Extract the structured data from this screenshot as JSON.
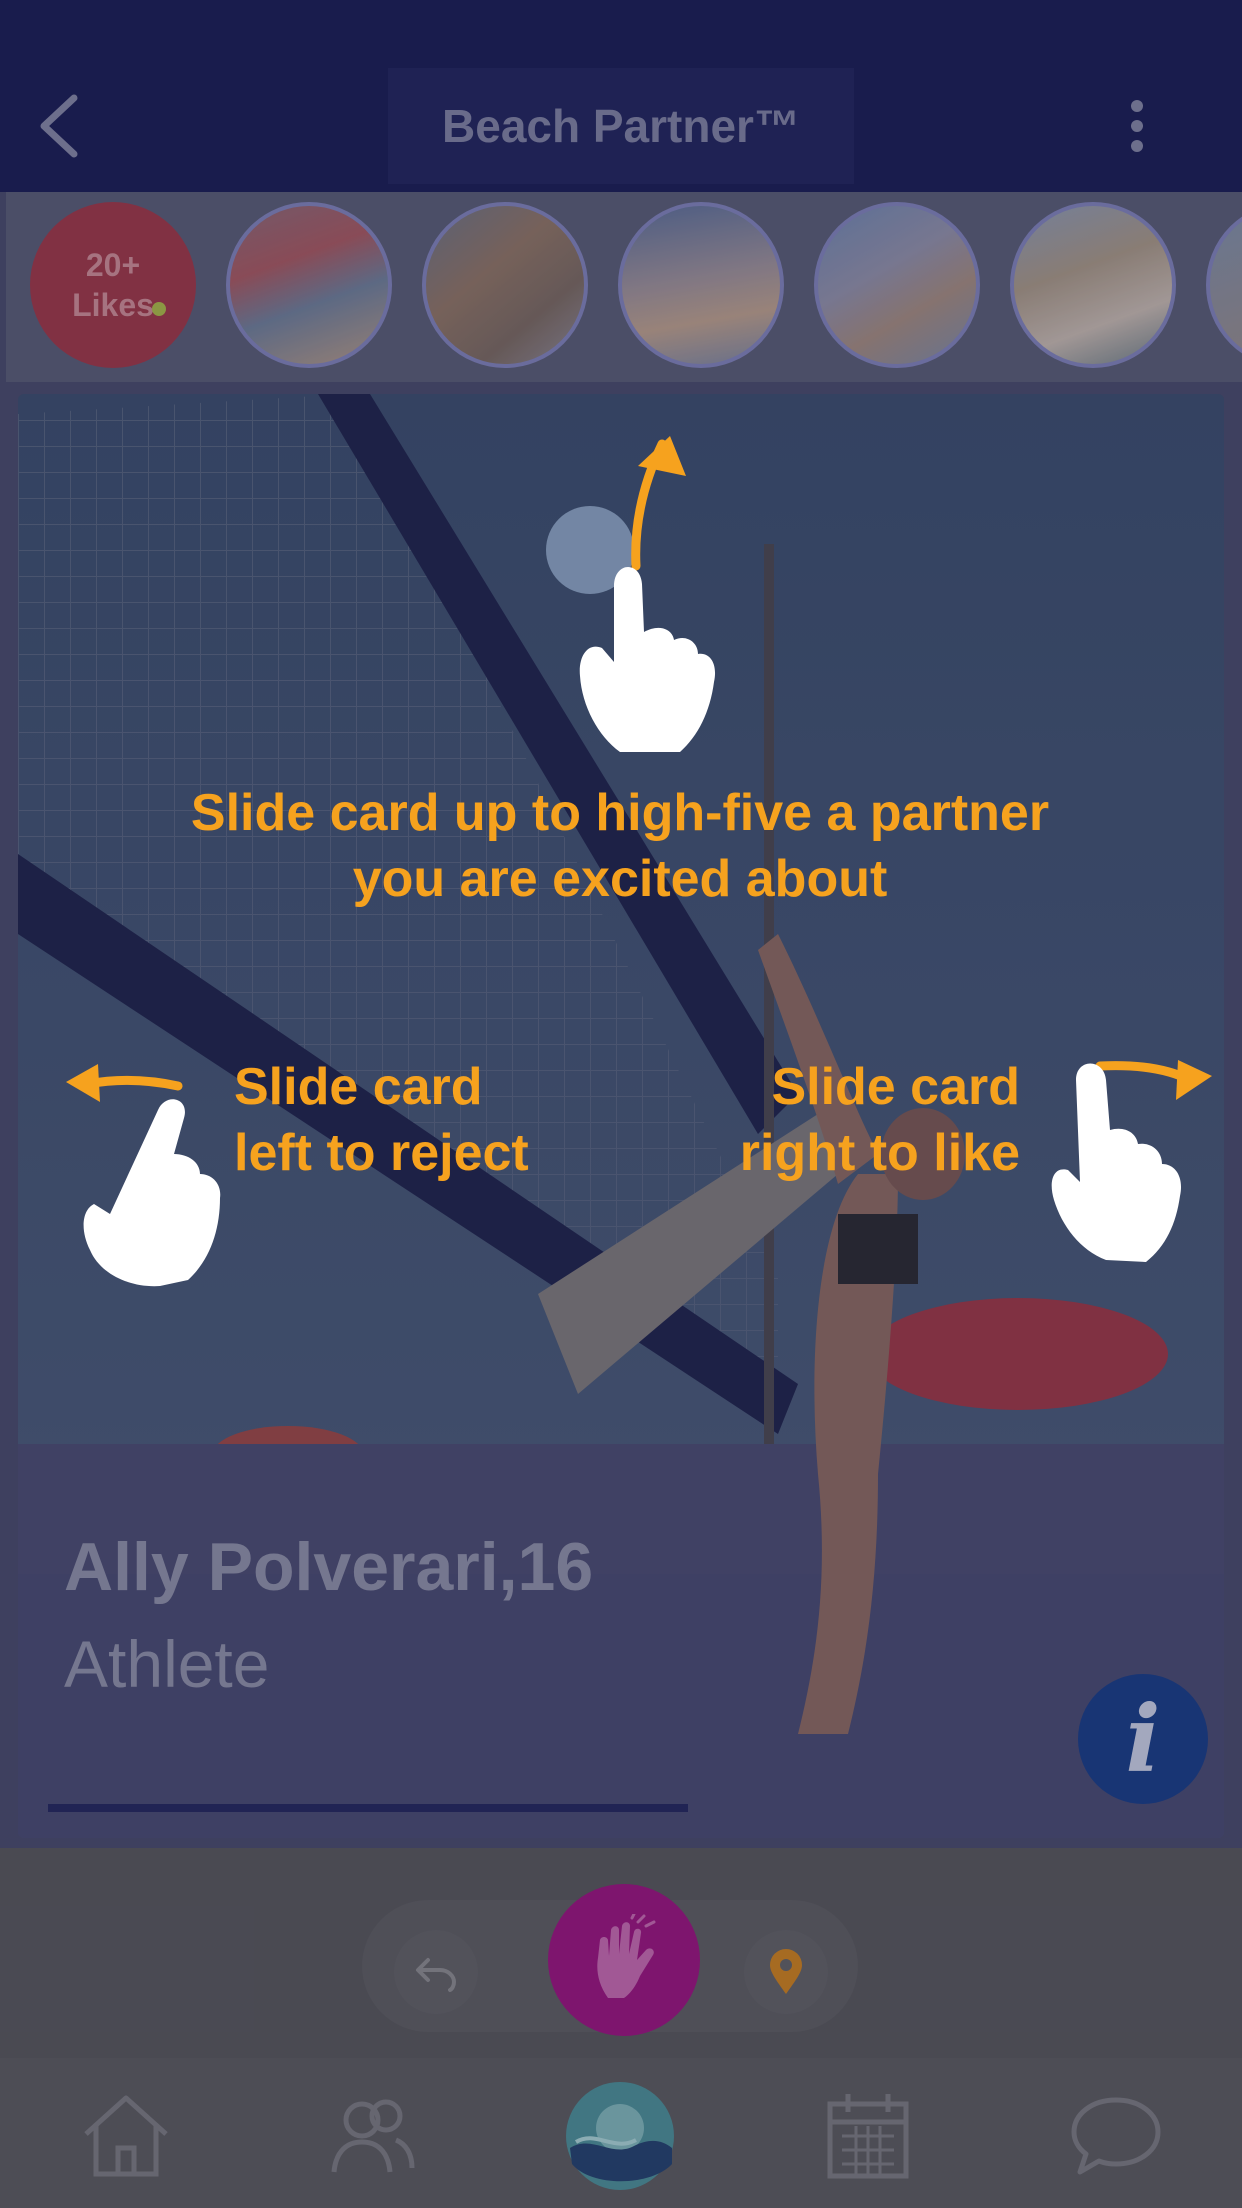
{
  "app_bar": {
    "title": "Beach Partner™",
    "back_icon": "chevron-left-icon",
    "menu_icon": "more-vertical-icon"
  },
  "likes_badge": {
    "line1": "20+",
    "line2": "Likes"
  },
  "card": {
    "name": "Ally Polverari,16",
    "role": "Athlete",
    "info_icon": "info-icon",
    "info_label": "i"
  },
  "coach_marks": {
    "up": "Slide card up to high-five a partner you are excited about",
    "left": "Slide card left to reject",
    "right": "Slide card right to like"
  },
  "actions": {
    "undo_icon": "undo-icon",
    "high_five_icon": "high-five-icon",
    "location_icon": "location-pin-icon"
  },
  "tabs": [
    "home-icon",
    "people-icon",
    "logo-icon",
    "calendar-icon",
    "chat-icon"
  ],
  "colors": {
    "app_bar": "#1d2056",
    "coach_text": "#f6a21e",
    "high_five": "#98187e",
    "info": "#1b3f86"
  }
}
